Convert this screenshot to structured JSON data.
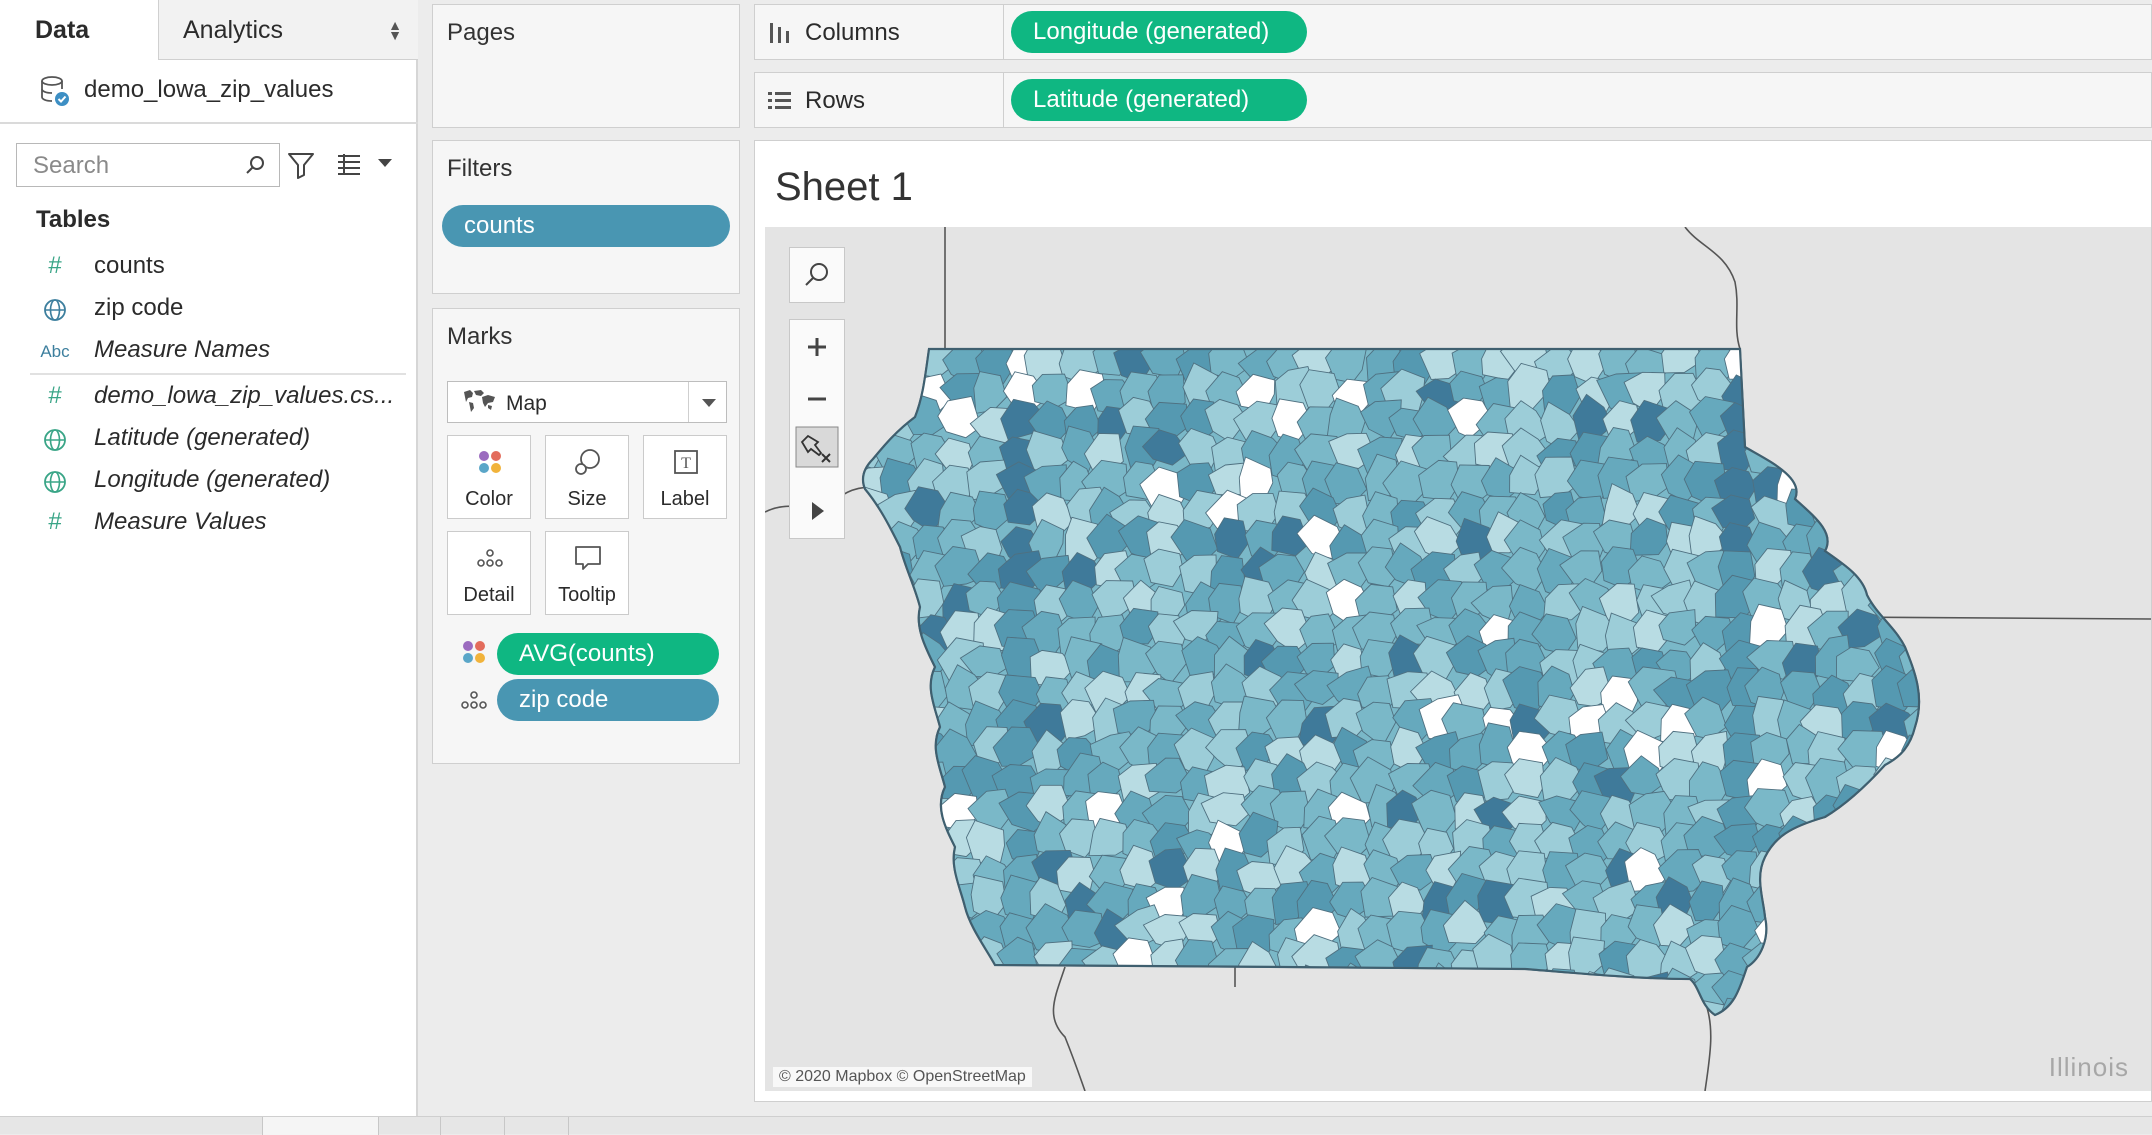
{
  "data_pane": {
    "tabs": [
      "Data",
      "Analytics"
    ],
    "datasource": "demo_lowa_zip_values",
    "search_placeholder": "Search",
    "tables_heading": "Tables",
    "fields": [
      {
        "icon": "#",
        "name": "counts"
      },
      {
        "icon": "globe",
        "name": "zip code"
      },
      {
        "icon": "Abc",
        "name": "Measure Names"
      },
      {
        "icon": "#",
        "name": "demo_lowa_zip_values.cs..."
      },
      {
        "icon": "globe",
        "name": "Latitude (generated)"
      },
      {
        "icon": "globe",
        "name": "Longitude (generated)"
      },
      {
        "icon": "#",
        "name": "Measure Values"
      }
    ]
  },
  "cards": {
    "pages": "Pages",
    "filters": "Filters",
    "filter_pills": [
      "counts"
    ],
    "marks": "Marks",
    "mark_type": "Map",
    "mark_buttons": [
      "Color",
      "Size",
      "Label",
      "Detail",
      "Tooltip"
    ],
    "mark_pills": [
      {
        "role": "color",
        "label": "AVG(counts)"
      },
      {
        "role": "detail",
        "label": "zip code"
      }
    ]
  },
  "shelves": {
    "columns_label": "Columns",
    "columns_pill": "Longitude (generated)",
    "rows_label": "Rows",
    "rows_pill": "Latitude (generated)"
  },
  "view": {
    "sheet_title": "Sheet 1",
    "attribution": "© 2020 Mapbox © OpenStreetMap",
    "neighbor_label": "Illinois"
  },
  "colors": {
    "pill_green": "#0fb782",
    "pill_blue": "#4996b2",
    "map_dark": "#3f7a9a",
    "map_mid": "#7ab8c8",
    "map_light": "#b8dce3"
  }
}
